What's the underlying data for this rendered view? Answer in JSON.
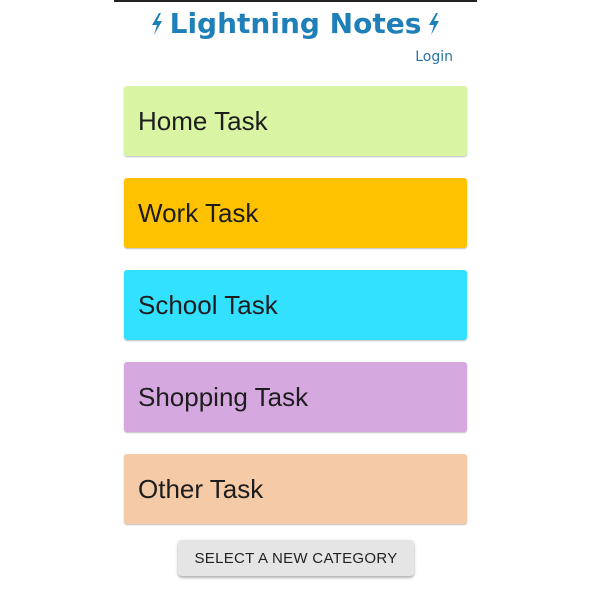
{
  "header": {
    "title": "Lightning Notes",
    "title_color": "#1f7fb8",
    "left_icon": "lightning-bolt-icon",
    "right_icon": "lightning-bolt-icon"
  },
  "nav": {
    "login_label": "Login",
    "login_color": "#2c73ab"
  },
  "categories": [
    {
      "label": "Home Task",
      "color": "#d9f5a3"
    },
    {
      "label": "Work Task",
      "color": "#ffc200"
    },
    {
      "label": "School Task",
      "color": "#32e0ff"
    },
    {
      "label": "Shopping Task",
      "color": "#d6a8e0"
    },
    {
      "label": "Other Task",
      "color": "#f5caa6"
    }
  ],
  "actions": {
    "select_category_label": "SELECT A NEW CATEGORY"
  }
}
